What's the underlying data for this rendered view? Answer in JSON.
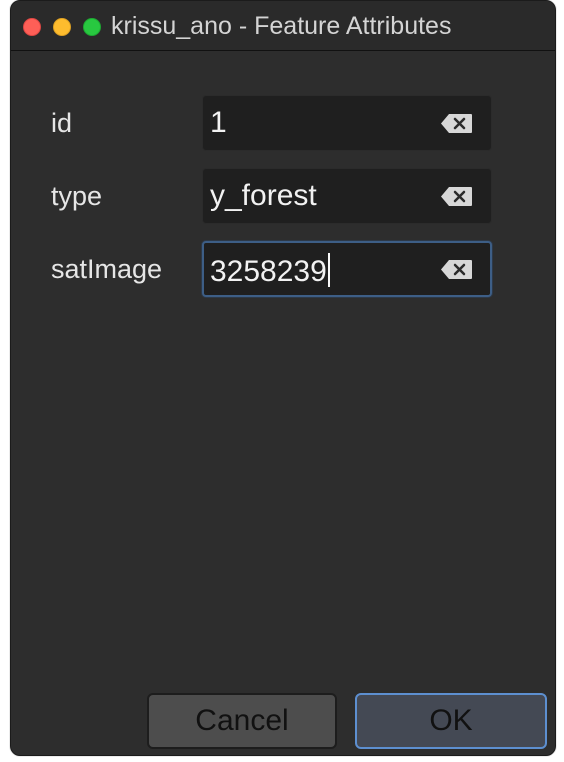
{
  "window": {
    "title": "krissu_ano - Feature Attributes"
  },
  "icons": {
    "close": "close-window-icon",
    "minimize": "minimize-window-icon",
    "zoom": "zoom-window-icon",
    "clear": "backspace-clear-icon"
  },
  "colors": {
    "close": "#fe5f57",
    "minimize": "#febc2e",
    "zoom": "#28c840",
    "focus": "#3d5e86",
    "ok_border": "#5d8fd0"
  },
  "fields": [
    {
      "label": "id",
      "value": "1",
      "focused": false
    },
    {
      "label": "type",
      "value": "y_forest",
      "focused": false
    },
    {
      "label": "satImage",
      "value": "3258239",
      "focused": true
    }
  ],
  "buttons": {
    "cancel": "Cancel",
    "ok": "OK"
  }
}
